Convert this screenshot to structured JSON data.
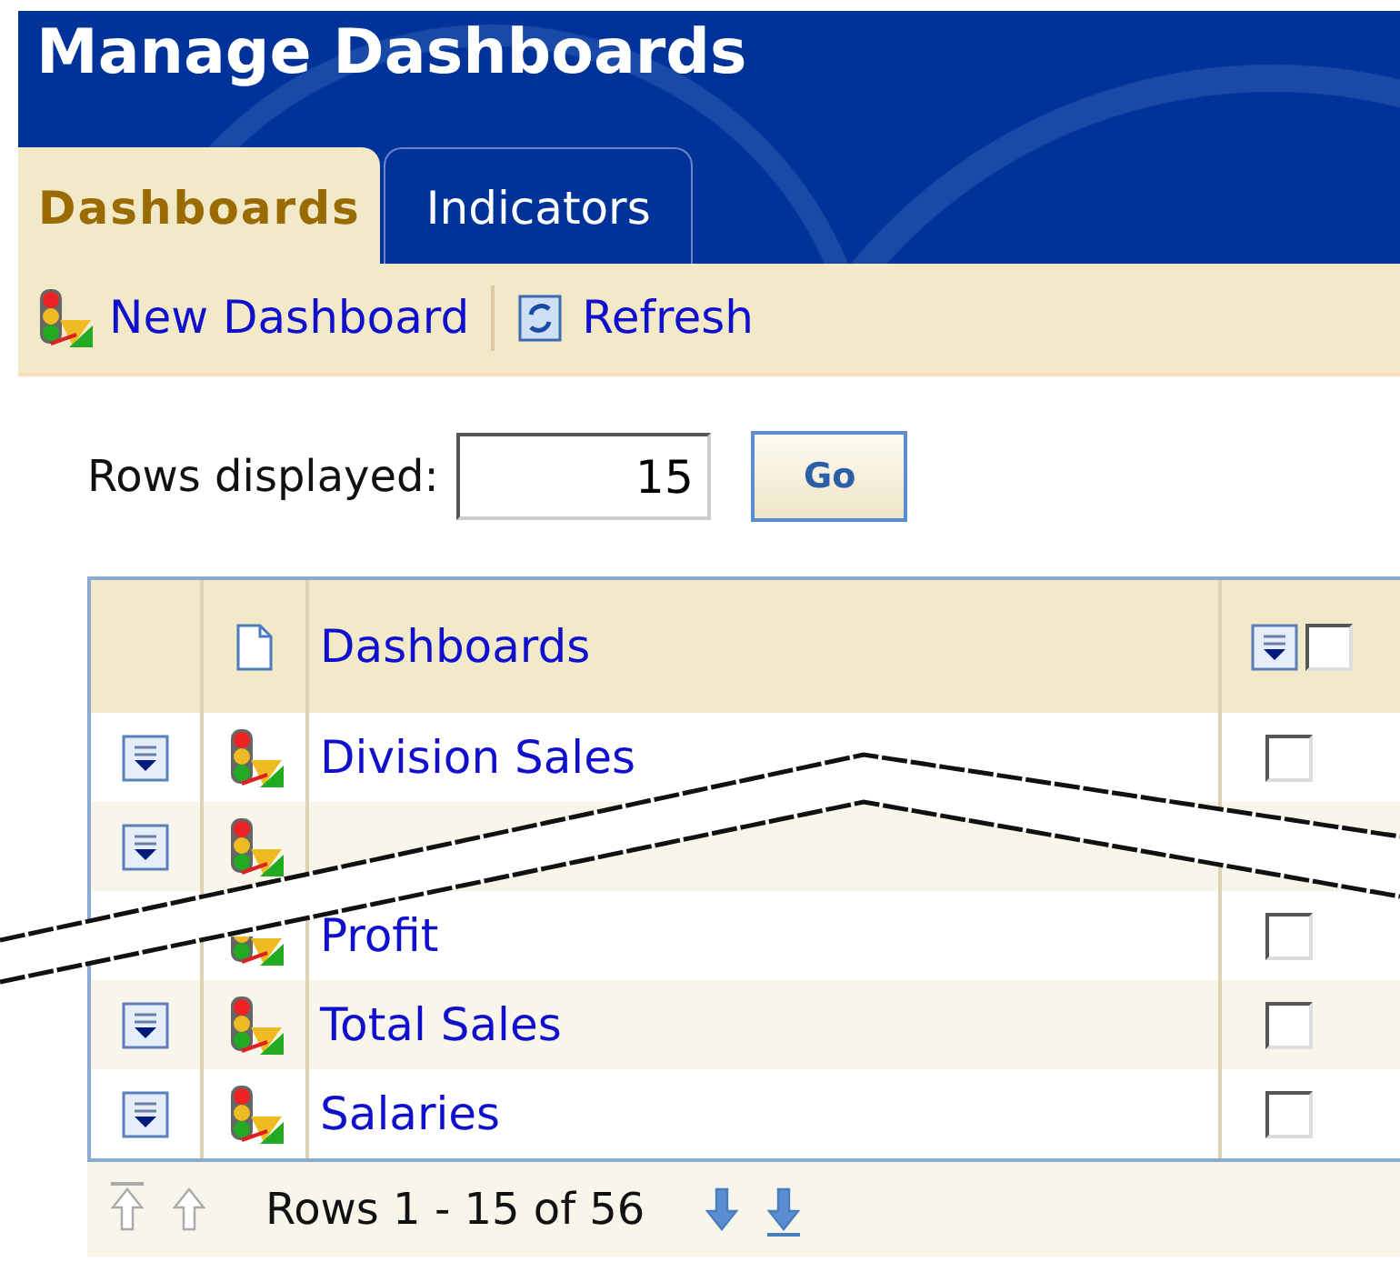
{
  "window": {
    "title": "Manage Dashboards"
  },
  "tabs": [
    {
      "label": "Dashboards",
      "selected": true
    },
    {
      "label": "Indicators",
      "selected": false
    }
  ],
  "toolbar": [
    {
      "kind": "new",
      "label": "New Dashboard"
    },
    {
      "kind": "refresh",
      "label": "Refresh"
    }
  ],
  "rows_control": {
    "label": "Rows displayed:",
    "value": "15",
    "button": "Go"
  },
  "table": {
    "columns": [
      {
        "kind": "menu"
      },
      {
        "kind": "icon"
      },
      {
        "kind": "name",
        "label": "Dashboards"
      },
      {
        "kind": "select",
        "checked": false
      }
    ],
    "rows": [
      {
        "name": "Division Sales",
        "menu": true,
        "checked": false
      },
      {
        "menu": true
      },
      {
        "name": "Profit",
        "menu": false,
        "kind": "torn",
        "checked": false
      },
      {
        "name": "Total Sales",
        "menu": true,
        "checked": false
      },
      {
        "name": "Salaries",
        "menu": true,
        "checked": false
      }
    ]
  },
  "pager": {
    "text": "Rows 1 - 15 of 56",
    "first_enabled": false,
    "prev_enabled": false,
    "next_enabled": true,
    "last_enabled": true
  }
}
